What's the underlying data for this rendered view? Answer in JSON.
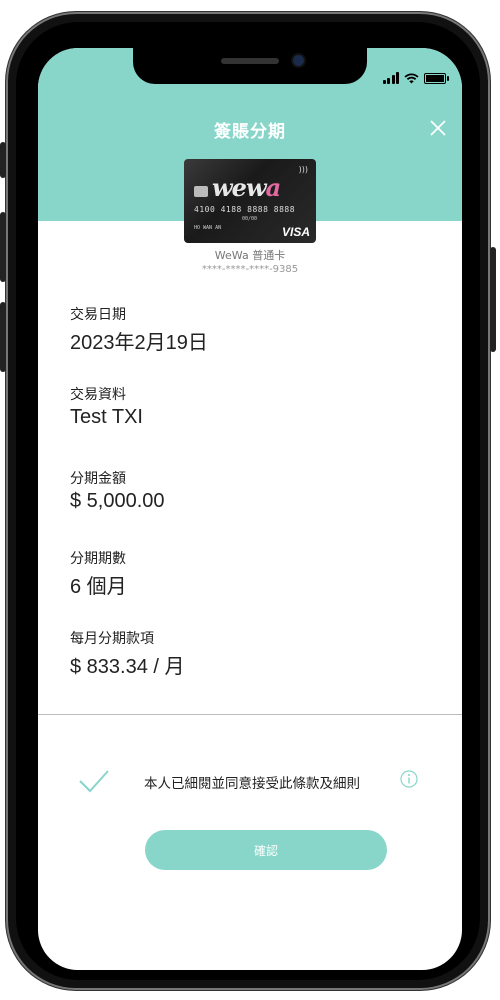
{
  "header": {
    "title": "簽賬分期",
    "background_color": "#87d6c9",
    "close_icon": "close-icon"
  },
  "card": {
    "logo_prefix": "we",
    "logo_w": "w",
    "logo_a": "a",
    "number": "4100 4188 8888 8888",
    "expiry": "00/00",
    "holder": "HO WAN AN",
    "network": "VISA",
    "name": "WeWa 普通卡",
    "masked_number": "****-****-****-9385"
  },
  "fields": [
    {
      "label": "交易日期",
      "value": "2023年2月19日"
    },
    {
      "label": "交易資料",
      "value": "Test TXI"
    },
    {
      "label": "分期金額",
      "value": "$ 5,000.00"
    },
    {
      "label": "分期期數",
      "value": "6 個月"
    },
    {
      "label": "每月分期款項",
      "value": "$ 833.34 / 月"
    }
  ],
  "agreement": {
    "text": "本人已細閱並同意接受此條款及細則",
    "check_icon": "checkmark-icon",
    "info_icon": "info-icon",
    "accent_color": "#87d6c9"
  },
  "confirm_button": {
    "label": "確認"
  }
}
